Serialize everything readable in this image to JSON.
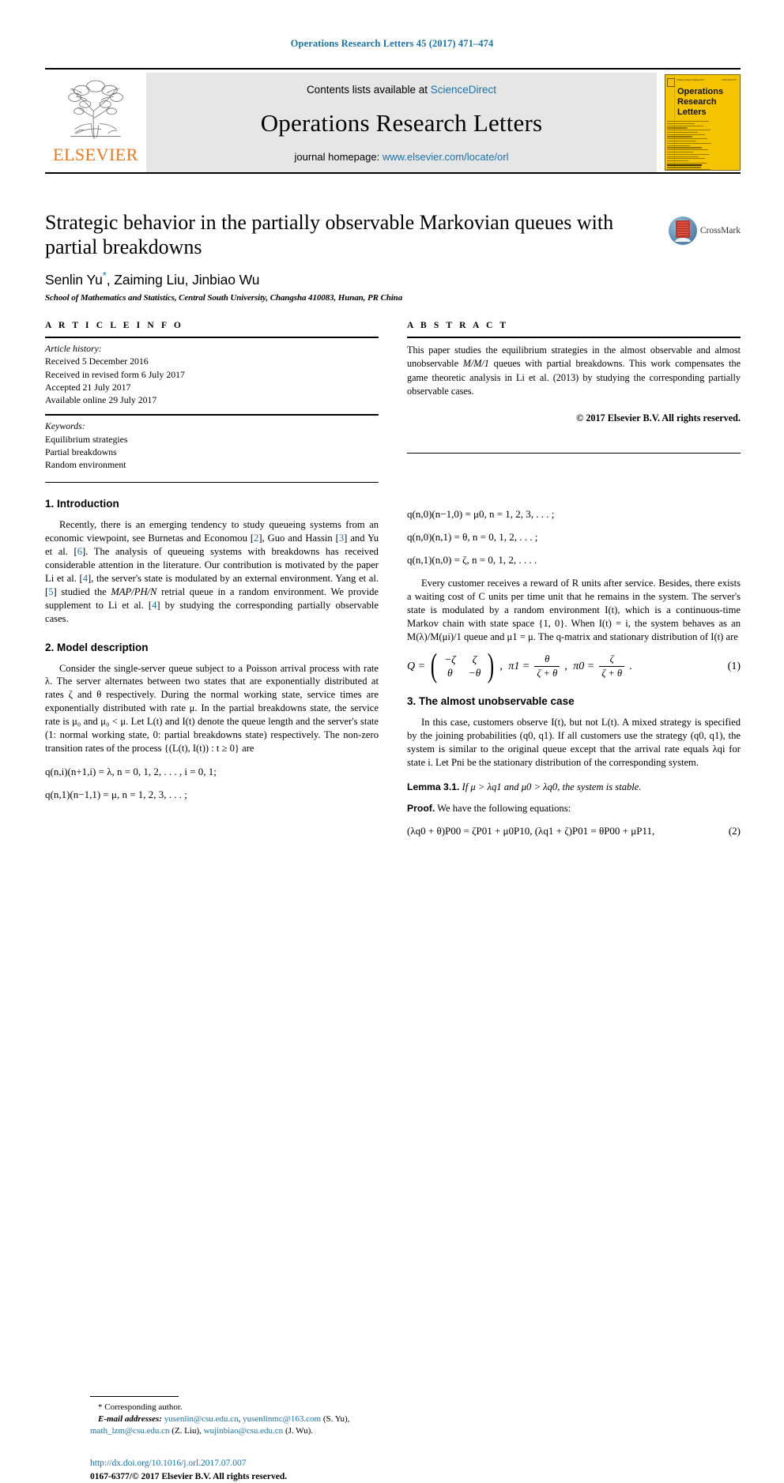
{
  "running_head": "Operations Research Letters 45 (2017) 471–474",
  "masthead": {
    "publisher_logo_label": "ELSEVIER",
    "contents_prefix": "Contents lists available at ",
    "contents_link": "ScienceDirect",
    "journal_name": "Operations Research Letters",
    "homepage_prefix": "journal homepage: ",
    "homepage_url": "www.elsevier.com/locate/orl",
    "cover": {
      "title_line1": "Operations",
      "title_line2": "Research",
      "title_line3": "Letters",
      "top_left": "Volume 45 Issue 5 January 2017",
      "top_right": "ISSN 0167-6377"
    }
  },
  "article": {
    "title": "Strategic behavior in the partially observable Markovian queues with partial breakdowns",
    "authors": "Senlin Yu",
    "authors_rest": ", Zaiming Liu, Jinbiao Wu",
    "corresponding_star": "*",
    "affiliation": "School of Mathematics and Statistics, Central South University, Changsha 410083, Hunan, PR China",
    "crossmark_label": "CrossMark"
  },
  "article_info": {
    "heading": "A R T I C L E   I N F O",
    "history_label": "Article history:",
    "history": [
      "Received 5 December 2016",
      "Received in revised form 6 July 2017",
      "Accepted 21 July 2017",
      "Available online 29 July 2017"
    ],
    "keywords_label": "Keywords:",
    "keywords": [
      "Equilibrium strategies",
      "Partial breakdowns",
      "Random environment"
    ]
  },
  "abstract": {
    "heading": "A B S T R A C T",
    "text_part1": "This paper studies the equilibrium strategies in the almost observable and almost unobservable ",
    "text_mmm1": "M/M/1",
    "text_part2": " queues with partial breakdowns. This work compensates the game theoretic analysis in Li et al. (2013) by studying the corresponding partially observable cases.",
    "copyright": "© 2017 Elsevier B.V. All rights reserved."
  },
  "sections": {
    "introduction": {
      "number_title": "1.  Introduction",
      "p1_a": "Recently, there is an emerging tendency to study queueing systems from an economic viewpoint, see Burnetas and Economou [",
      "ref2": "2",
      "p1_b": "], Guo and Hassin [",
      "ref3": "3",
      "p1_c": "] and Yu et al. [",
      "ref6": "6",
      "p1_d": "]. The analysis of queueing systems with breakdowns has received considerable attention in the literature. Our contribution is motivated by the paper Li et al. [",
      "ref4": "4",
      "p1_e": "], the server's state is modulated by an external environment. Yang et al. [",
      "ref5": "5",
      "p1_f": "] studied the ",
      "mapphn": "MAP/PH/N",
      "p1_g": " retrial queue in a random environment. We provide supplement to Li et al. [",
      "ref4b": "4",
      "p1_h": "] by studying the corresponding partially observable cases."
    },
    "model": {
      "number_title": "2.  Model description",
      "p1": "Consider the single-server queue subject to a Poisson arrival process with rate λ. The server alternates between two states that are exponentially distributed at rates ζ and θ respectively. During the normal working state, service times are exponentially distributed with rate μ. In the partial breakdowns state, the service rate is μ₀ and μ₀ < μ. Let L(t) and I(t) denote the queue length and the server's state (1: normal working state, 0: partial breakdowns state) respectively. The non-zero transition rates of the process {(L(t), I(t)) : t ≥ 0} are",
      "eq_a": "q(n,i)(n+1,i) = λ,  n = 0, 1, 2, . . . , i = 0, 1;",
      "eq_b": "q(n,1)(n−1,1) = μ,  n = 1, 2, 3, . . . ;",
      "eq_c": "q(n,0)(n−1,0) = μ0,  n = 1, 2, 3, . . . ;",
      "eq_d": "q(n,0)(n,1) = θ,  n = 0, 1, 2, . . . ;",
      "eq_e": "q(n,1)(n,0) = ζ,  n = 0, 1, 2, . . . .",
      "p2": "Every customer receives a reward of R units after service. Besides, there exists a waiting cost of C units per time unit that he remains in the system. The server's state is modulated by a random environment I(t), which is a continuous-time Markov chain with state space {1, 0}. When I(t)  =  i, the system behaves as an M(λ)/M(μi)/1 queue and μ1  =  μ. The q-matrix and stationary distribution of I(t) are",
      "eq1_number": "(1)",
      "eq1_Q": "Q =",
      "matrix": [
        "−ζ",
        "ζ",
        "θ",
        "−θ"
      ],
      "eq1_pi1_label": "π1 =",
      "eq1_pi1_num": "θ",
      "eq1_pi1_den": "ζ + θ",
      "eq1_pi0_label": "π0 =",
      "eq1_pi0_num": "ζ",
      "eq1_pi0_den": "ζ + θ",
      "eq1_tail": "."
    },
    "unobservable": {
      "number_title": "3.  The almost unobservable case",
      "p1": "In this case, customers observe I(t), but not L(t). A mixed strategy is specified by the joining probabilities (q0, q1). If all customers use the strategy (q0, q1), the system is similar to the original queue except that the arrival rate equals λqi for state i. Let Pni be the stationary distribution of the corresponding system.",
      "lemma_label": "Lemma 3.1.",
      "lemma_text": " If μ > λq1 and μ0 > λq0, the system is stable.",
      "proof_label": "Proof.",
      "proof_text": " We have the following equations:",
      "eq2": "(λq0 + θ)P00 = ζP01 + μ0P10,  (λq1 + ζ)P01 = θP00 + μP11,",
      "eq2_number": "(2)"
    }
  },
  "footnote": {
    "corresponding": "Corresponding author.",
    "email_label": "E-mail addresses:",
    "email1": "yusenlin@csu.edu.cn",
    "email2": "yusenlinmc@163.com",
    "email1_who": " (S. Yu),",
    "email3": "math_lzm@csu.edu.cn",
    "email3_who": " (Z. Liu),",
    "email4": "wujinbiao@csu.edu.cn",
    "email4_who": " (J. Wu).",
    "doi": "http://dx.doi.org/10.1016/j.orl.2017.07.007",
    "issn": "0167-6377/© 2017 Elsevier B.V. All rights reserved."
  },
  "colors": {
    "link_blue": "#1a72a8",
    "elsevier_orange": "#e87722",
    "cover_yellow": "#f5c400",
    "masthead_grey": "#e6e6e6"
  }
}
